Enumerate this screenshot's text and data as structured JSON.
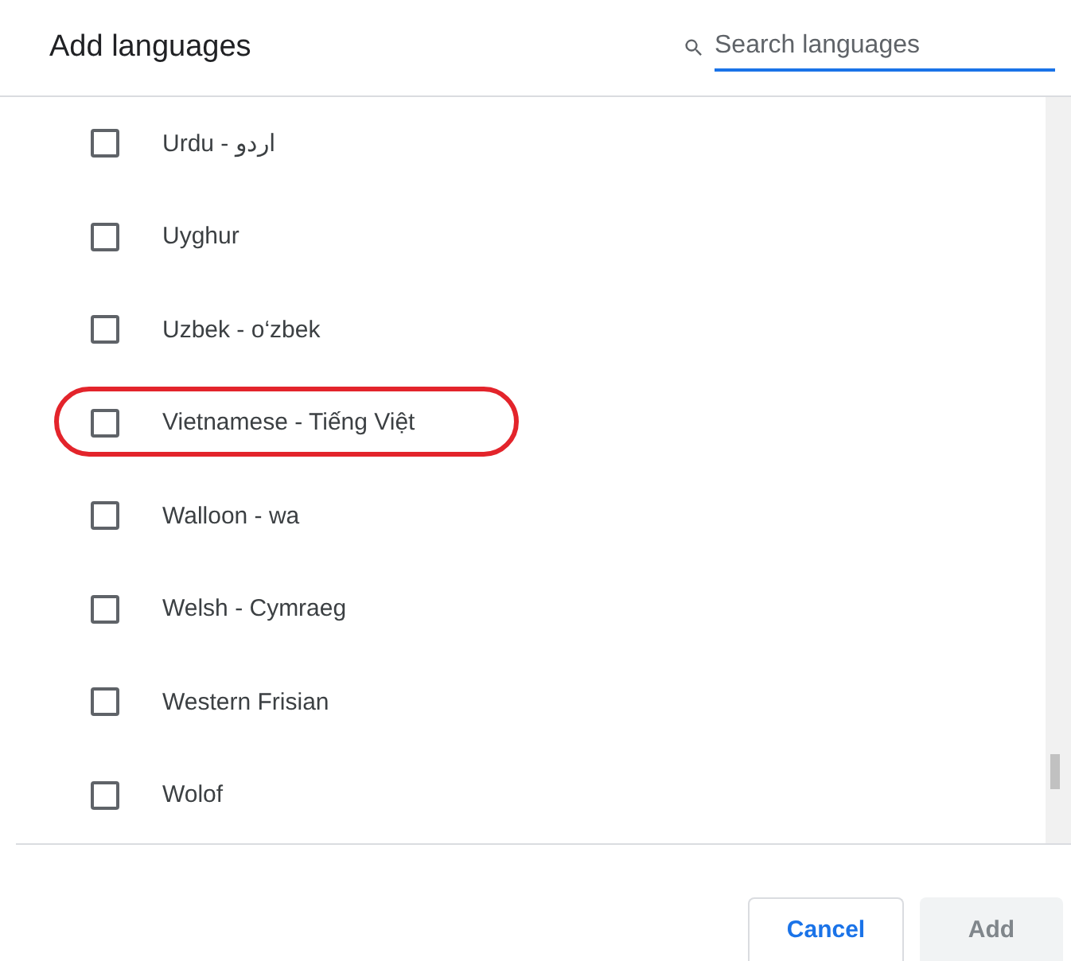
{
  "dialog": {
    "title": "Add languages"
  },
  "search": {
    "placeholder": "Search languages"
  },
  "languages": [
    {
      "label": "Urdu - اردو",
      "checked": false,
      "highlighted": false
    },
    {
      "label": "Uyghur",
      "checked": false,
      "highlighted": false
    },
    {
      "label": "Uzbek - o‘zbek",
      "checked": false,
      "highlighted": false
    },
    {
      "label": "Vietnamese - Tiếng Việt",
      "checked": false,
      "highlighted": true
    },
    {
      "label": "Walloon - wa",
      "checked": false,
      "highlighted": false
    },
    {
      "label": "Welsh - Cymraeg",
      "checked": false,
      "highlighted": false
    },
    {
      "label": "Western Frisian",
      "checked": false,
      "highlighted": false
    },
    {
      "label": "Wolof",
      "checked": false,
      "highlighted": false
    }
  ],
  "buttons": [
    {
      "label": "Cancel",
      "kind": "secondary",
      "disabled": false
    },
    {
      "label": "Add",
      "kind": "primary",
      "disabled": true
    }
  ]
}
